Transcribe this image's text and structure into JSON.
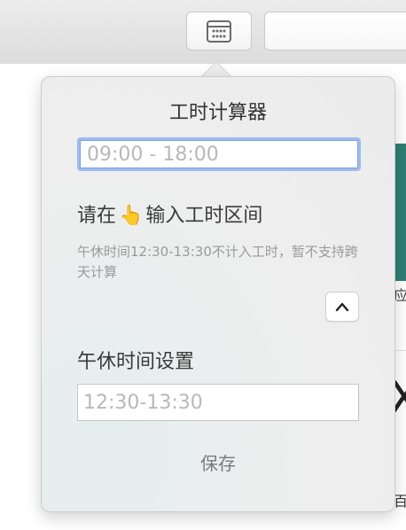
{
  "toolbar": {
    "calendar_icon": "calendar-grid-icon"
  },
  "background": {
    "glyph_1": "应",
    "glyph_2": "X",
    "glyph_3": "百"
  },
  "popover": {
    "title": "工时计算器",
    "range_input": {
      "placeholder": "09:00 - 18:00",
      "value": ""
    },
    "hint": {
      "prefix": "请在",
      "icon": "👆",
      "suffix": "输入工时区间"
    },
    "note": "午休时间12:30-13:30不计入工时，暂不支持跨天计算",
    "collapse_icon": "chevron-up-icon",
    "lunch_label": "午休时间设置",
    "lunch_input": {
      "placeholder": "12:30-13:30",
      "value": ""
    },
    "save_label": "保存"
  },
  "colors": {
    "focus_ring": "#9fbaf0",
    "placeholder": "#b8b8b8",
    "note_text": "#9a9a9a",
    "accent_teal": "#2f7f74"
  }
}
